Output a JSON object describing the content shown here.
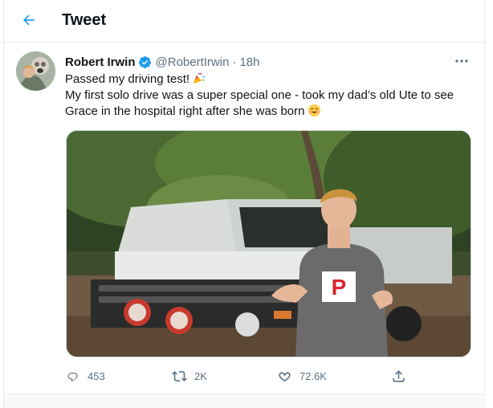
{
  "header": {
    "title": "Tweet",
    "back_icon": "arrow-left-icon"
  },
  "tweet": {
    "author": {
      "display_name": "Robert Irwin",
      "handle": "@RobertIrwin",
      "verified": true
    },
    "separator": "·",
    "time": "18h",
    "lines": [
      "Passed my driving test!",
      "My first solo drive was a super special one - took my dad’s old Ute to see",
      "Grace in the hospital right after she was born"
    ],
    "emojis": [
      "party-popper-icon",
      "smiling-face-icon"
    ],
    "media": {
      "plate_letter": "P"
    },
    "actions": {
      "replies": "453",
      "retweets": "2K",
      "likes": "72.6K"
    }
  },
  "colors": {
    "accent": "#1d9bf0",
    "muted": "#5b7083",
    "text": "#0f1419",
    "border": "#e6ecf0",
    "plate_red": "#d7262f"
  }
}
